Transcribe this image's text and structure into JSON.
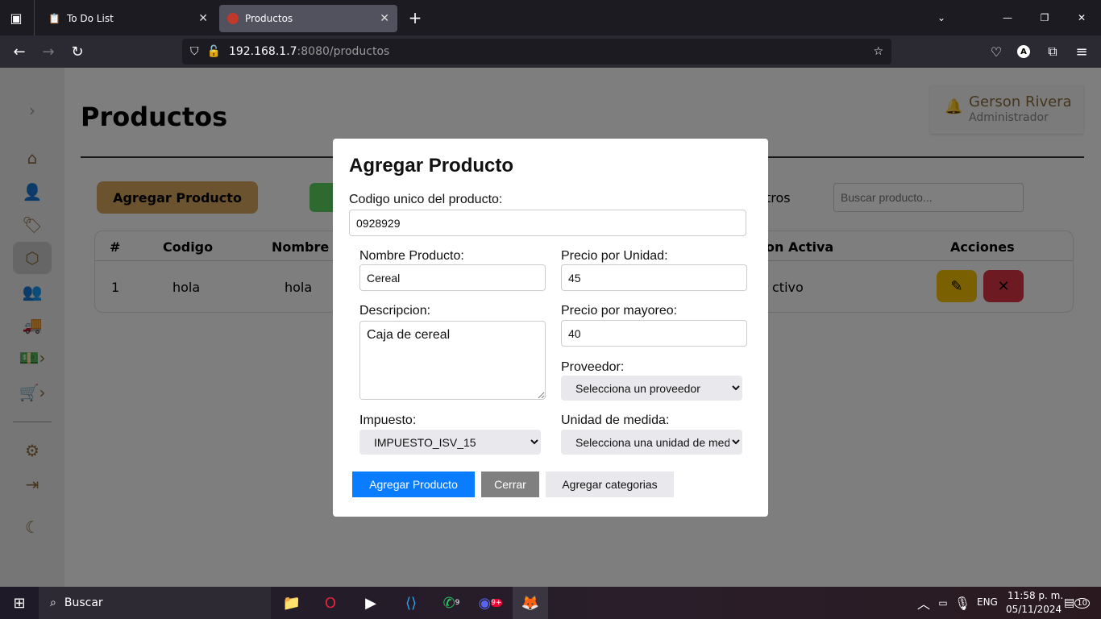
{
  "browser": {
    "tabs": [
      {
        "title": "To Do List"
      },
      {
        "title": "Productos"
      }
    ],
    "url_host": "192.168.1.7",
    "url_rest": ":8080/productos"
  },
  "page": {
    "title": "Productos",
    "add_button": "Agregar Producto",
    "filter_label": "tros",
    "search_placeholder": "Buscar producto...",
    "user": {
      "name": "Gerson Rivera",
      "role": "Administrador"
    },
    "table": {
      "headers": [
        "#",
        "Codigo",
        "Nombre",
        "on Activa",
        "Acciones"
      ],
      "rows": [
        {
          "num": "1",
          "codigo": "hola",
          "nombre": "hola",
          "estado": "ctivo"
        }
      ]
    }
  },
  "modal": {
    "title": "Agregar Producto",
    "codigo_label": "Codigo unico del producto:",
    "codigo_value": "0928929",
    "nombre_label": "Nombre Producto:",
    "nombre_value": "Cereal",
    "precio_label": "Precio por Unidad:",
    "precio_value": "45",
    "descripcion_label": "Descripcion:",
    "descripcion_value": "Caja de cereal",
    "mayoreo_label": "Precio por mayoreo:",
    "mayoreo_value": "40",
    "proveedor_label": "Proveedor:",
    "proveedor_value": "Selecciona un proveedor",
    "impuesto_label": "Impuesto:",
    "impuesto_value": "IMPUESTO_ISV_15",
    "unidad_label": "Unidad de medida:",
    "unidad_value": "Selecciona una unidad de medida",
    "submit": "Agregar Producto",
    "close": "Cerrar",
    "categories": "Agregar categorias"
  },
  "taskbar": {
    "search": "Buscar",
    "lang": "ENG",
    "time": "11:58 p. m.",
    "date": "05/11/2024",
    "notif_count": "10",
    "whatsapp_badge": "9",
    "discord_badge": "9+"
  },
  "colors": {
    "primary": "#0a7cff",
    "brand": "#d6a660",
    "edit": "#f5c000",
    "delete": "#dc3545"
  }
}
